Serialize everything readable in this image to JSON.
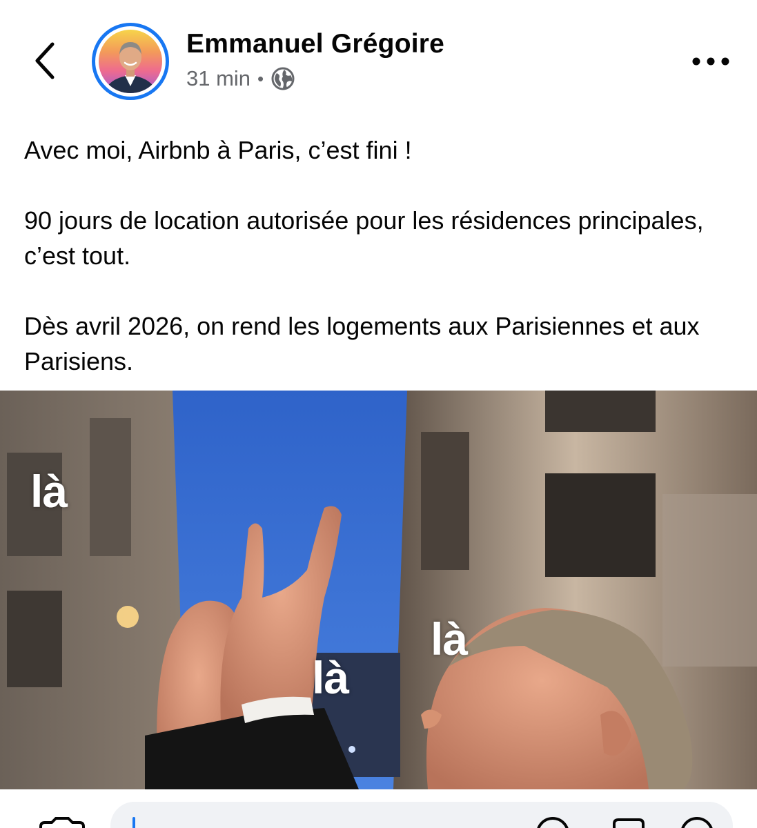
{
  "post": {
    "author_name": "Emmanuel Grégoire",
    "time": "31 min",
    "separator": "•",
    "audience_icon": "globe-icon",
    "paragraphs": [
      "Avec moi, Airbnb à Paris, c’est fini !",
      "90 jours de location autorisée pour les résidences principales, c’est tout.",
      "Dès avril 2026, on rend les logements aux Parisiennes et aux Parisiens."
    ],
    "image_captions": [
      "là",
      "là",
      "là"
    ]
  },
  "icons": {
    "back": "chevron-left-icon",
    "more": "more-horizontal-icon",
    "camera": "camera-icon",
    "emoji": "emoji-icon",
    "gif": "gif-icon",
    "sticker": "sticker-icon"
  },
  "colors": {
    "accent": "#1877f2",
    "text_primary": "#050505",
    "text_secondary": "#65676b",
    "input_bg": "#f0f2f5"
  }
}
